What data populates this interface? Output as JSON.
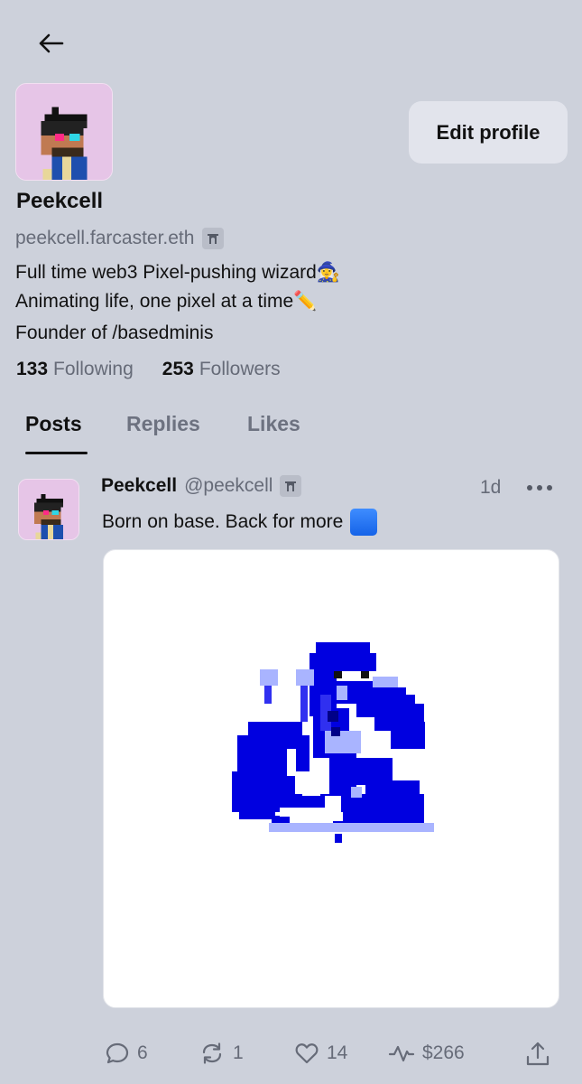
{
  "nav": {
    "back_icon": "arrow-left-icon"
  },
  "profile": {
    "display_name": "Peekcell",
    "handle": "peekcell.farcaster.eth",
    "verified_icon": "farcaster-arch-icon",
    "edit_label": "Edit profile",
    "bio": [
      "Full time web3 Pixel-pushing wizard🧙‍♀️",
      "Animating life, one pixel at a time✏️",
      "Founder of /basedminis"
    ],
    "following_count": "133",
    "following_label": "Following",
    "followers_count": "253",
    "followers_label": "Followers"
  },
  "tabs": [
    {
      "label": "Posts",
      "active": true
    },
    {
      "label": "Replies",
      "active": false
    },
    {
      "label": "Likes",
      "active": false
    }
  ],
  "post": {
    "author_name": "Peekcell",
    "author_handle": "@peekcell",
    "time": "1d",
    "more_icon": "more-horizontal-icon",
    "text": "Born on base. Back for more",
    "text_emoji": "blue-square-emoji",
    "media_icon": "pixel-art-image",
    "actions": {
      "replies": "6",
      "recasts": "1",
      "likes": "14",
      "tips": "$266"
    }
  },
  "colors": {
    "background": "#cdd1db",
    "avatar_bg": "#e6c5e7",
    "pixel_blue": "#0000e0",
    "pixel_light": "#a9b4ff",
    "muted_text": "#666b78"
  }
}
